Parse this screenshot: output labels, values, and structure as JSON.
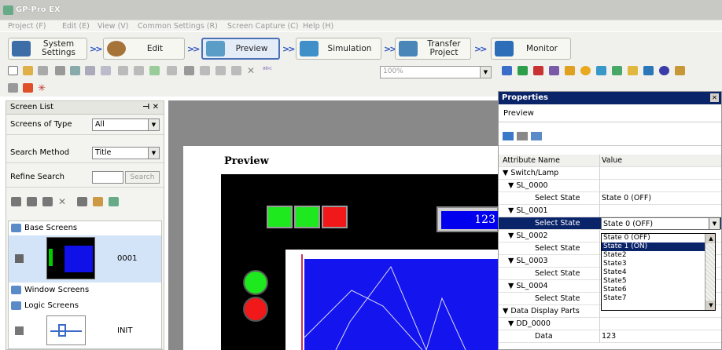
{
  "app": {
    "title": "GP-Pro EX"
  },
  "menu": [
    "Project (F)",
    "Edit (E)",
    "View (V)",
    "Common Settings (R)",
    "Screen Capture (C)",
    "Help (H)"
  ],
  "workflow": [
    {
      "line1": "System",
      "line2": "Settings"
    },
    {
      "line1": "Edit",
      "line2": ""
    },
    {
      "line1": "Preview",
      "line2": ""
    },
    {
      "line1": "Simulation",
      "line2": ""
    },
    {
      "line1": "Transfer",
      "line2": "Project"
    },
    {
      "line1": "Monitor",
      "line2": ""
    }
  ],
  "toolbar": {
    "zoom": "100%"
  },
  "screen_list": {
    "title": "Screen List",
    "type_label": "Screens of Type",
    "type_value": "All",
    "search_label": "Search Method",
    "search_value": "Title",
    "refine_label": "Refine Search",
    "refine_button": "Search",
    "groups": {
      "base": "Base Screens",
      "window": "Window Screens",
      "logic": "Logic Screens"
    },
    "items": {
      "base_number": "0001",
      "logic_name": "INIT"
    }
  },
  "preview": {
    "title": "Preview",
    "data_value": "123"
  },
  "properties": {
    "title": "Properties",
    "subtitle": "Preview",
    "col_name": "Attribute Name",
    "col_value": "Value",
    "rows": [
      {
        "name": "▼ Switch/Lamp",
        "value": ""
      },
      {
        "name": "▼ SL_0000",
        "value": ""
      },
      {
        "name": "Select State",
        "value": "State 0 (OFF)"
      },
      {
        "name": "▼ SL_0001",
        "value": ""
      },
      {
        "name": "Select State",
        "value": "State 0 (OFF)"
      },
      {
        "name": "▼ SL_0002",
        "value": ""
      },
      {
        "name": "Select State",
        "value": ""
      },
      {
        "name": "▼ SL_0003",
        "value": ""
      },
      {
        "name": "Select State",
        "value": ""
      },
      {
        "name": "▼ SL_0004",
        "value": ""
      },
      {
        "name": "Select State",
        "value": ""
      },
      {
        "name": "▼ Data Display Parts",
        "value": ""
      },
      {
        "name": "▼ DD_0000",
        "value": ""
      },
      {
        "name": "Data",
        "value": "123"
      }
    ],
    "options": [
      "State 0 (OFF)",
      "State 1 (ON)",
      "State2",
      "State3",
      "State4",
      "State5",
      "State6",
      "State7"
    ]
  }
}
